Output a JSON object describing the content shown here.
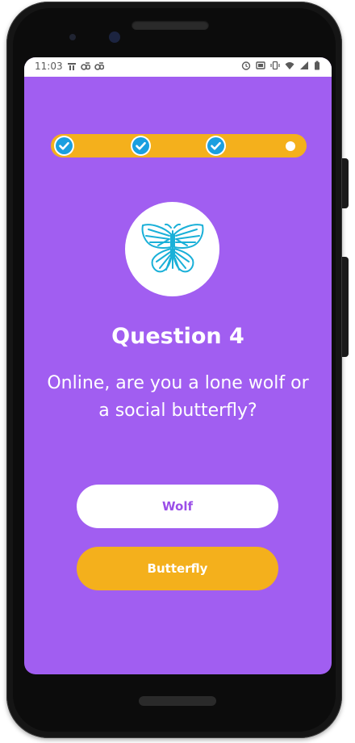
{
  "status_bar": {
    "time": "11:03",
    "left_icons": [
      "notification-icon",
      "data-saver-icon",
      "data-saver-icon"
    ],
    "right_icons": [
      "alarm-icon",
      "cast-icon",
      "vibrate-icon",
      "wifi-icon",
      "signal-icon",
      "battery-icon"
    ]
  },
  "progress": {
    "total_steps": 4,
    "completed_steps": 3,
    "current_step": 4,
    "steps": [
      {
        "state": "done"
      },
      {
        "state": "done"
      },
      {
        "state": "done"
      },
      {
        "state": "current"
      }
    ]
  },
  "question": {
    "icon": "butterfly-icon",
    "title": "Question 4",
    "text": "Online, are you a lone wolf or a social butterfly?"
  },
  "answers": {
    "wolf_label": "Wolf",
    "butterfly_label": "Butterfly"
  },
  "colors": {
    "background": "#a15ef1",
    "accent": "#f4b01c",
    "check": "#1a9fe0",
    "icon_stroke": "#1ab0d8",
    "wolf_text": "#9b4fe8"
  }
}
